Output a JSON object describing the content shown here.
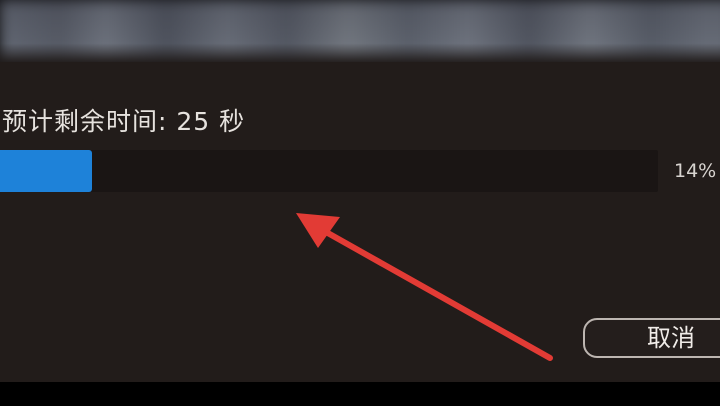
{
  "dialog": {
    "remaining_label": "预计剩余时间: 25 秒",
    "progress_percent_text": "14%",
    "progress_fraction": 0.14,
    "cancel_label": "取消"
  },
  "colors": {
    "dialog_bg": "#221c1a",
    "progress_fill": "#1e82d9",
    "progress_track": "#1a1514",
    "annotation_arrow": "#e23b35"
  },
  "annotation": {
    "icon": "red-arrow-icon"
  }
}
